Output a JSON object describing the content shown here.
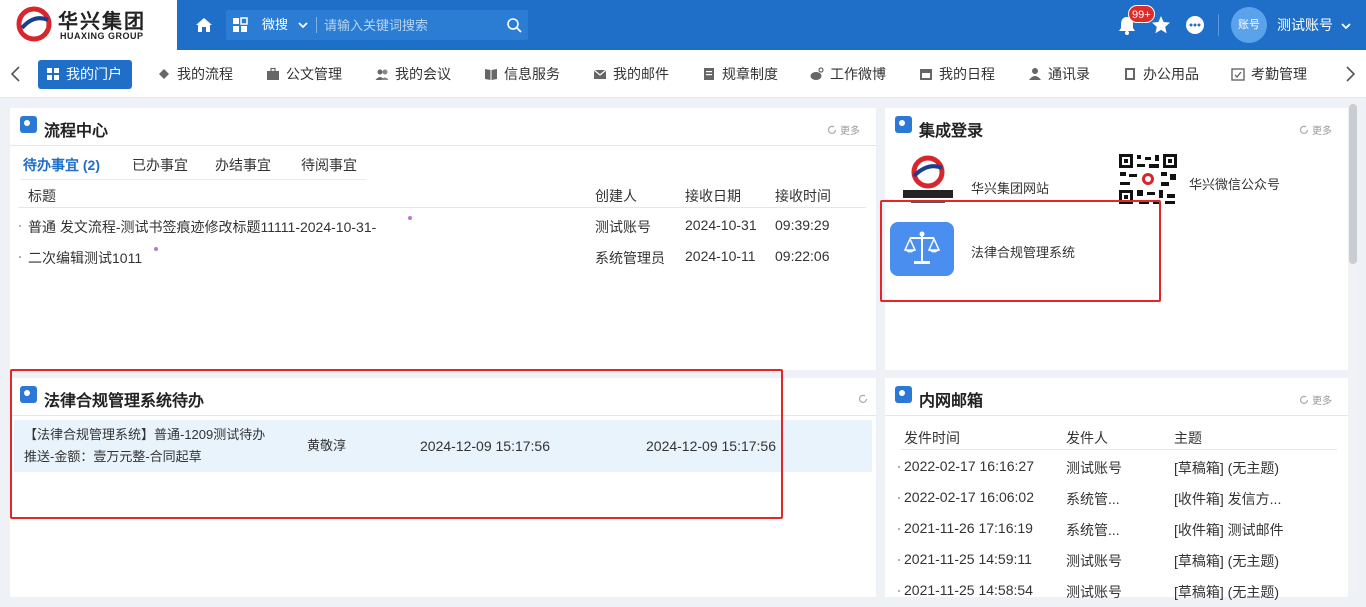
{
  "brand": {
    "name_cn": "华兴集团",
    "name_en": "HUAXING GROUP",
    "colors": {
      "primary": "#1f6fc8",
      "accent_red": "#e32626"
    }
  },
  "header": {
    "search_scope": "微搜",
    "search_placeholder": "请输入关键词搜索",
    "notification_badge": "99+",
    "avatar_text": "账号",
    "user_name": "测试账号"
  },
  "nav": {
    "items": [
      {
        "label": "我的门户",
        "icon": "grid-icon"
      },
      {
        "label": "我的流程",
        "icon": "workflow-icon"
      },
      {
        "label": "公文管理",
        "icon": "briefcase-icon"
      },
      {
        "label": "我的会议",
        "icon": "people-icon"
      },
      {
        "label": "信息服务",
        "icon": "book-icon"
      },
      {
        "label": "我的邮件",
        "icon": "mail-icon"
      },
      {
        "label": "规章制度",
        "icon": "document-icon"
      },
      {
        "label": "工作微博",
        "icon": "weibo-icon"
      },
      {
        "label": "我的日程",
        "icon": "calendar-icon"
      },
      {
        "label": "通讯录",
        "icon": "contact-icon"
      },
      {
        "label": "办公用品",
        "icon": "supplies-icon"
      },
      {
        "label": "考勤管理",
        "icon": "attendance-icon"
      }
    ]
  },
  "process_center": {
    "title": "流程中心",
    "more": "更多",
    "tabs": [
      "待办事宜 (2)",
      "已办事宜",
      "办结事宜",
      "待阅事宜"
    ],
    "columns": [
      "标题",
      "创建人",
      "接收日期",
      "接收时间"
    ],
    "rows": [
      {
        "title": "普通 发文流程-测试书签痕迹修改标题11111-2024-10-31-",
        "creator": "测试账号",
        "date": "2024-10-31",
        "time": "09:39:29"
      },
      {
        "title": "二次编辑测试1011",
        "creator": "系统管理员",
        "date": "2024-10-11",
        "time": "09:22:06"
      }
    ]
  },
  "integrated_login": {
    "title": "集成登录",
    "more": "更多",
    "systems": [
      {
        "label": "华兴集团网站",
        "icon": "huaxing-logo-icon"
      },
      {
        "label": "华兴微信公众号",
        "icon": "qr-code-icon"
      },
      {
        "label": "法律合规管理系统",
        "icon": "scales-icon"
      }
    ]
  },
  "legal_todo": {
    "title": "法律合规管理系统待办",
    "row": {
      "title_line1": "【法律合规管理系统】普通-1209测试待办",
      "title_line2": "推送-金额：壹万元整-合同起草",
      "person": "黄敬淳",
      "time1": "2024-12-09 15:17:56",
      "time2": "2024-12-09 15:17:56"
    }
  },
  "mailbox": {
    "title": "内网邮箱",
    "more": "更多",
    "columns": [
      "发件时间",
      "发件人",
      "主题"
    ],
    "rows": [
      {
        "time": "2022-02-17 16:16:27",
        "sender": "测试账号",
        "subject": "[草稿箱] (无主题)"
      },
      {
        "time": "2022-02-17 16:06:02",
        "sender": "系统管...",
        "subject": "[收件箱] 发信方..."
      },
      {
        "time": "2021-11-26 17:16:19",
        "sender": "系统管...",
        "subject": "[收件箱] 测试邮件"
      },
      {
        "time": "2021-11-25 14:59:11",
        "sender": "测试账号",
        "subject": "[草稿箱] (无主题)"
      },
      {
        "time": "2021-11-25 14:58:54",
        "sender": "测试账号",
        "subject": "[草稿箱] (无主题)"
      }
    ]
  }
}
